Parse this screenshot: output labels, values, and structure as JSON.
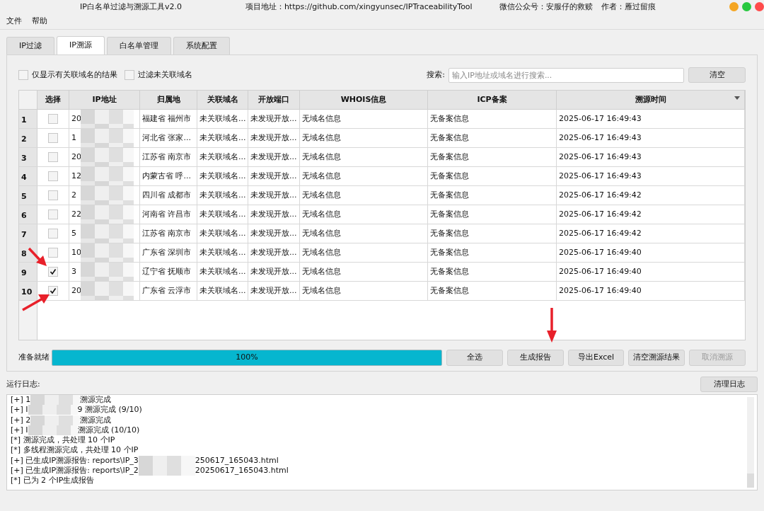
{
  "window": {
    "title": "IP白名单过滤与溯源工具v2.0",
    "project": "项目地址：https://github.com/xingyunsec/IPTraceabilityTool",
    "wechat": "微信公众号：安服仔的救赎",
    "author": "作者：雁过留痕"
  },
  "menu": [
    "文件",
    "帮助"
  ],
  "tabs": [
    {
      "label": "IP过滤",
      "selected": false
    },
    {
      "label": "IP溯源",
      "selected": true
    },
    {
      "label": "白名单管理",
      "selected": false
    },
    {
      "label": "系统配置",
      "selected": false
    }
  ],
  "filters": [
    {
      "label": "仅显示有关联域名的结果",
      "checked": false
    },
    {
      "label": "过滤未关联域名",
      "checked": false
    }
  ],
  "search": {
    "label": "搜索:",
    "placeholder": "输入IP地址或域名进行搜索...",
    "button": "清空"
  },
  "table": {
    "columns": [
      "选择",
      "IP地址",
      "归属地",
      "关联域名",
      "开放端口",
      "WHOIS信息",
      "ICP备案",
      "溯源时间"
    ],
    "rows": [
      {
        "index": "1",
        "checked": false,
        "ip": "20",
        "location": "福建省 福州市",
        "domain": "未关联域名...",
        "ports": "未发现开放...",
        "whois": "无域名信息",
        "icp": "无备案信息",
        "time": "2025-06-17 16:49:43"
      },
      {
        "index": "2",
        "checked": false,
        "ip": "1",
        "location": "河北省 张家...",
        "domain": "未关联域名...",
        "ports": "未发现开放...",
        "whois": "无域名信息",
        "icp": "无备案信息",
        "time": "2025-06-17 16:49:43"
      },
      {
        "index": "3",
        "checked": false,
        "ip": "20",
        "location": "江苏省 南京市",
        "domain": "未关联域名...",
        "ports": "未发现开放...",
        "whois": "无域名信息",
        "icp": "无备案信息",
        "time": "2025-06-17 16:49:43"
      },
      {
        "index": "4",
        "checked": false,
        "ip": "12",
        "location": "内蒙古省 呼...",
        "domain": "未关联域名...",
        "ports": "未发现开放...",
        "whois": "无域名信息",
        "icp": "无备案信息",
        "time": "2025-06-17 16:49:43"
      },
      {
        "index": "5",
        "checked": false,
        "ip": "2",
        "location": "四川省 成都市",
        "domain": "未关联域名...",
        "ports": "未发现开放...",
        "whois": "无域名信息",
        "icp": "无备案信息",
        "time": "2025-06-17 16:49:42"
      },
      {
        "index": "6",
        "checked": false,
        "ip": "22",
        "location": "河南省 许昌市",
        "domain": "未关联域名...",
        "ports": "未发现开放...",
        "whois": "无域名信息",
        "icp": "无备案信息",
        "time": "2025-06-17 16:49:42"
      },
      {
        "index": "7",
        "checked": false,
        "ip": "5",
        "location": "江苏省 南京市",
        "domain": "未关联域名...",
        "ports": "未发现开放...",
        "whois": "无域名信息",
        "icp": "无备案信息",
        "time": "2025-06-17 16:49:42"
      },
      {
        "index": "8",
        "checked": false,
        "ip": "10",
        "location": "广东省 深圳市",
        "domain": "未关联域名...",
        "ports": "未发现开放...",
        "whois": "无域名信息",
        "icp": "无备案信息",
        "time": "2025-06-17 16:49:40"
      },
      {
        "index": "9",
        "checked": true,
        "ip": "3",
        "location": "辽宁省 抚顺市",
        "domain": "未关联域名...",
        "ports": "未发现开放...",
        "whois": "无域名信息",
        "icp": "无备案信息",
        "time": "2025-06-17 16:49:40"
      },
      {
        "index": "10",
        "checked": true,
        "ip": "20",
        "location": "广东省 云浮市",
        "domain": "未关联域名...",
        "ports": "未发现开放...",
        "whois": "无域名信息",
        "icp": "无备案信息",
        "time": "2025-06-17 16:49:40"
      }
    ]
  },
  "status": "准备就绪",
  "progress": {
    "level": 1,
    "reading": "100%"
  },
  "actions": [
    {
      "label": "全选",
      "disabled": false
    },
    {
      "label": "生成报告",
      "disabled": false
    },
    {
      "label": "导出Excel",
      "disabled": false
    },
    {
      "label": "清空溯源结果",
      "disabled": false
    },
    {
      "label": "取消溯源",
      "disabled": true
    }
  ],
  "log": {
    "label": "运行日志:",
    "button": "清理日志",
    "lines": [
      {
        "before": "[+] 1",
        "after": "溯源完成"
      },
      {
        "before": "[+] I",
        "after": "9 溯源完成 (9/10)"
      },
      {
        "before": "[+] 2",
        "after": "溯源完成"
      },
      {
        "before": "[+] I",
        "after": "溯源完成 (10/10)"
      },
      {
        "before": "[*] 溯源完成，共处理 10 个IP"
      },
      {
        "before": "[*] 多线程溯源完成，共处理 10 个IP"
      },
      {
        "before": "[+] 已生成IP溯源报告: reports\\IP_3",
        "after": "250617_165043.html"
      },
      {
        "before": "[+] 已生成IP溯源报告: reports\\IP_2",
        "after": "20250617_165043.html"
      },
      {
        "before": "[*] 已为 2 个IP生成报告"
      }
    ]
  }
}
